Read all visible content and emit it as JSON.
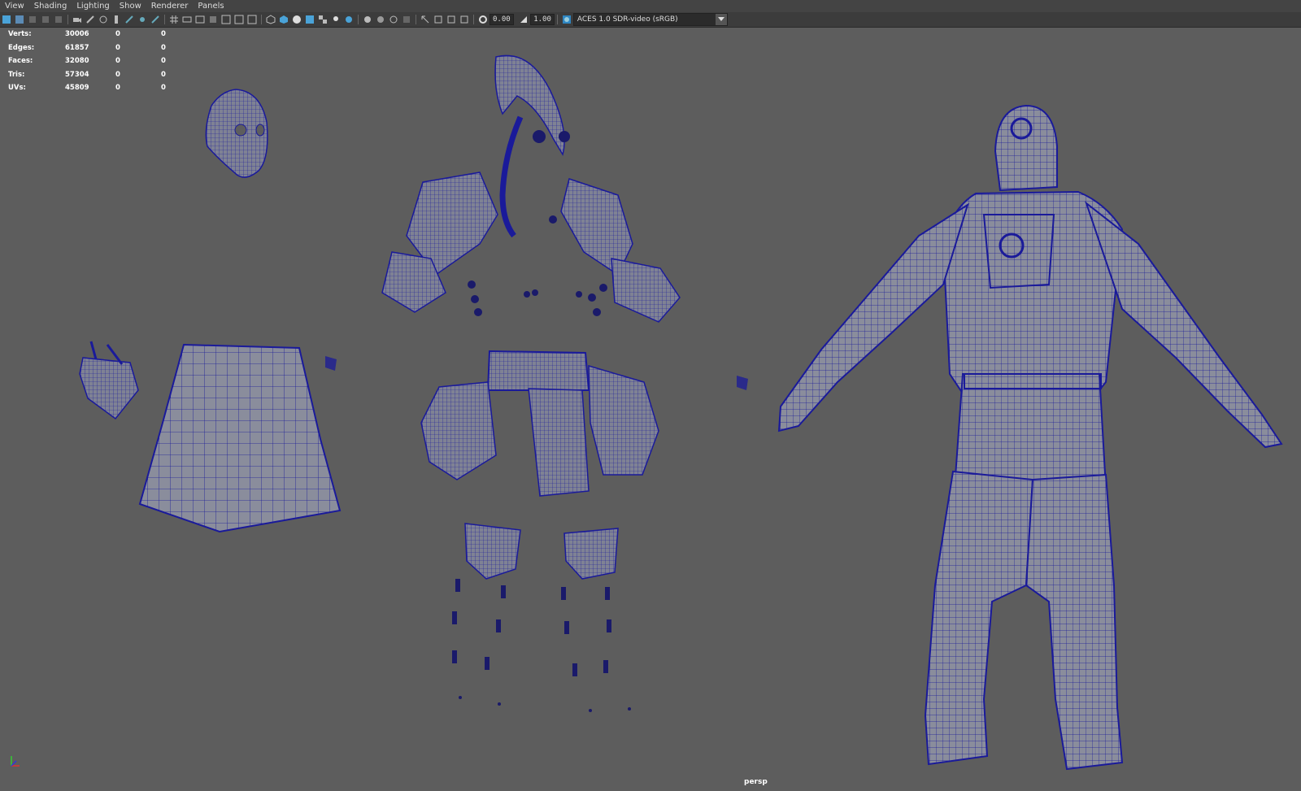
{
  "menu": [
    "View",
    "Shading",
    "Lighting",
    "Show",
    "Renderer",
    "Panels"
  ],
  "toolbar": {
    "exposure": "0.00",
    "gamma": "1.00",
    "color_management": "ACES 1.0 SDR-video (sRGB)"
  },
  "hud": [
    {
      "label": "Verts:",
      "v1": "30006",
      "v2": "0",
      "v3": "0"
    },
    {
      "label": "Edges:",
      "v1": "61857",
      "v2": "0",
      "v3": "0"
    },
    {
      "label": "Faces:",
      "v1": "32080",
      "v2": "0",
      "v3": "0"
    },
    {
      "label": "Tris:",
      "v1": "57304",
      "v2": "0",
      "v3": "0"
    },
    {
      "label": "UVs:",
      "v1": "45809",
      "v2": "0",
      "v3": "0"
    }
  ],
  "camera_label": "persp",
  "colors": {
    "wire": "#1a1a9a",
    "mesh": "#8a8d9c",
    "viewport": "#5d5d5d"
  }
}
